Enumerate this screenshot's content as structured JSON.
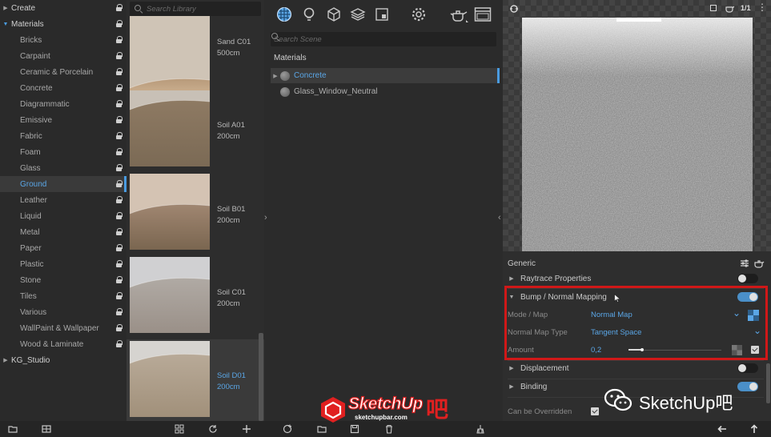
{
  "library": {
    "tree": [
      {
        "label": "Create",
        "level": 0,
        "expanded": false
      },
      {
        "label": "Materials",
        "level": 0,
        "expanded": true
      },
      {
        "label": "Bricks",
        "level": 1
      },
      {
        "label": "Carpaint",
        "level": 1
      },
      {
        "label": "Ceramic & Porcelain",
        "level": 1
      },
      {
        "label": "Concrete",
        "level": 1
      },
      {
        "label": "Diagrammatic",
        "level": 1
      },
      {
        "label": "Emissive",
        "level": 1
      },
      {
        "label": "Fabric",
        "level": 1
      },
      {
        "label": "Foam",
        "level": 1
      },
      {
        "label": "Glass",
        "level": 1
      },
      {
        "label": "Ground",
        "level": 1,
        "selected": true
      },
      {
        "label": "Leather",
        "level": 1
      },
      {
        "label": "Liquid",
        "level": 1
      },
      {
        "label": "Metal",
        "level": 1
      },
      {
        "label": "Paper",
        "level": 1
      },
      {
        "label": "Plastic",
        "level": 1
      },
      {
        "label": "Stone",
        "level": 1
      },
      {
        "label": "Tiles",
        "level": 1
      },
      {
        "label": "Various",
        "level": 1
      },
      {
        "label": "WallPaint & Wallpaper",
        "level": 1
      },
      {
        "label": "Wood & Laminate",
        "level": 1
      },
      {
        "label": "KG_Studio",
        "level": 0,
        "expanded": false
      }
    ],
    "search_placeholder": "Search Library",
    "thumbnails": [
      {
        "name": "Sand C01",
        "size": "500cm"
      },
      {
        "name": "Soil A01",
        "size": "200cm"
      },
      {
        "name": "Soil B01",
        "size": "200cm"
      },
      {
        "name": "Soil C01",
        "size": "200cm"
      },
      {
        "name": "Soil D01",
        "size": "200cm",
        "selected": true
      }
    ]
  },
  "scene": {
    "toolbar_icons": [
      "materials-icon",
      "lightbulb-icon",
      "cube-icon",
      "layers-icon",
      "texture-icon",
      "gear-icon",
      "teapot-icon",
      "window-icon"
    ],
    "search_placeholder": "Search Scene",
    "heading": "Materials",
    "materials": [
      {
        "name": "Concrete",
        "selected": true
      },
      {
        "name": "Glass_Window_Neutral",
        "selected": false
      }
    ]
  },
  "preview": {
    "page_counter": "1/1"
  },
  "editor": {
    "section_title": "Generic",
    "raytrace": {
      "label": "Raytrace Properties",
      "enabled": false
    },
    "bump": {
      "label": "Bump / Normal Mapping",
      "enabled": true,
      "mode_label": "Mode / Map",
      "mode_value": "Normal Map",
      "type_label": "Normal Map Type",
      "type_value": "Tangent Space",
      "amount_label": "Amount",
      "amount_value": "0,2",
      "amount_fraction": 0.04
    },
    "displacement": {
      "label": "Displacement",
      "enabled": false
    },
    "binding": {
      "label": "Binding",
      "enabled": true
    },
    "overridden": {
      "label": "Can be Overridden",
      "checked": true
    }
  },
  "watermark": {
    "logo_text": "SketchUp",
    "logo_suffix": "吧",
    "logo_url": "sketchupbar.com",
    "wechat_text": "SketchUp吧"
  },
  "colors": {
    "accent": "#4a9be0",
    "highlight_box": "#d01818",
    "logo_red": "#e02020"
  }
}
